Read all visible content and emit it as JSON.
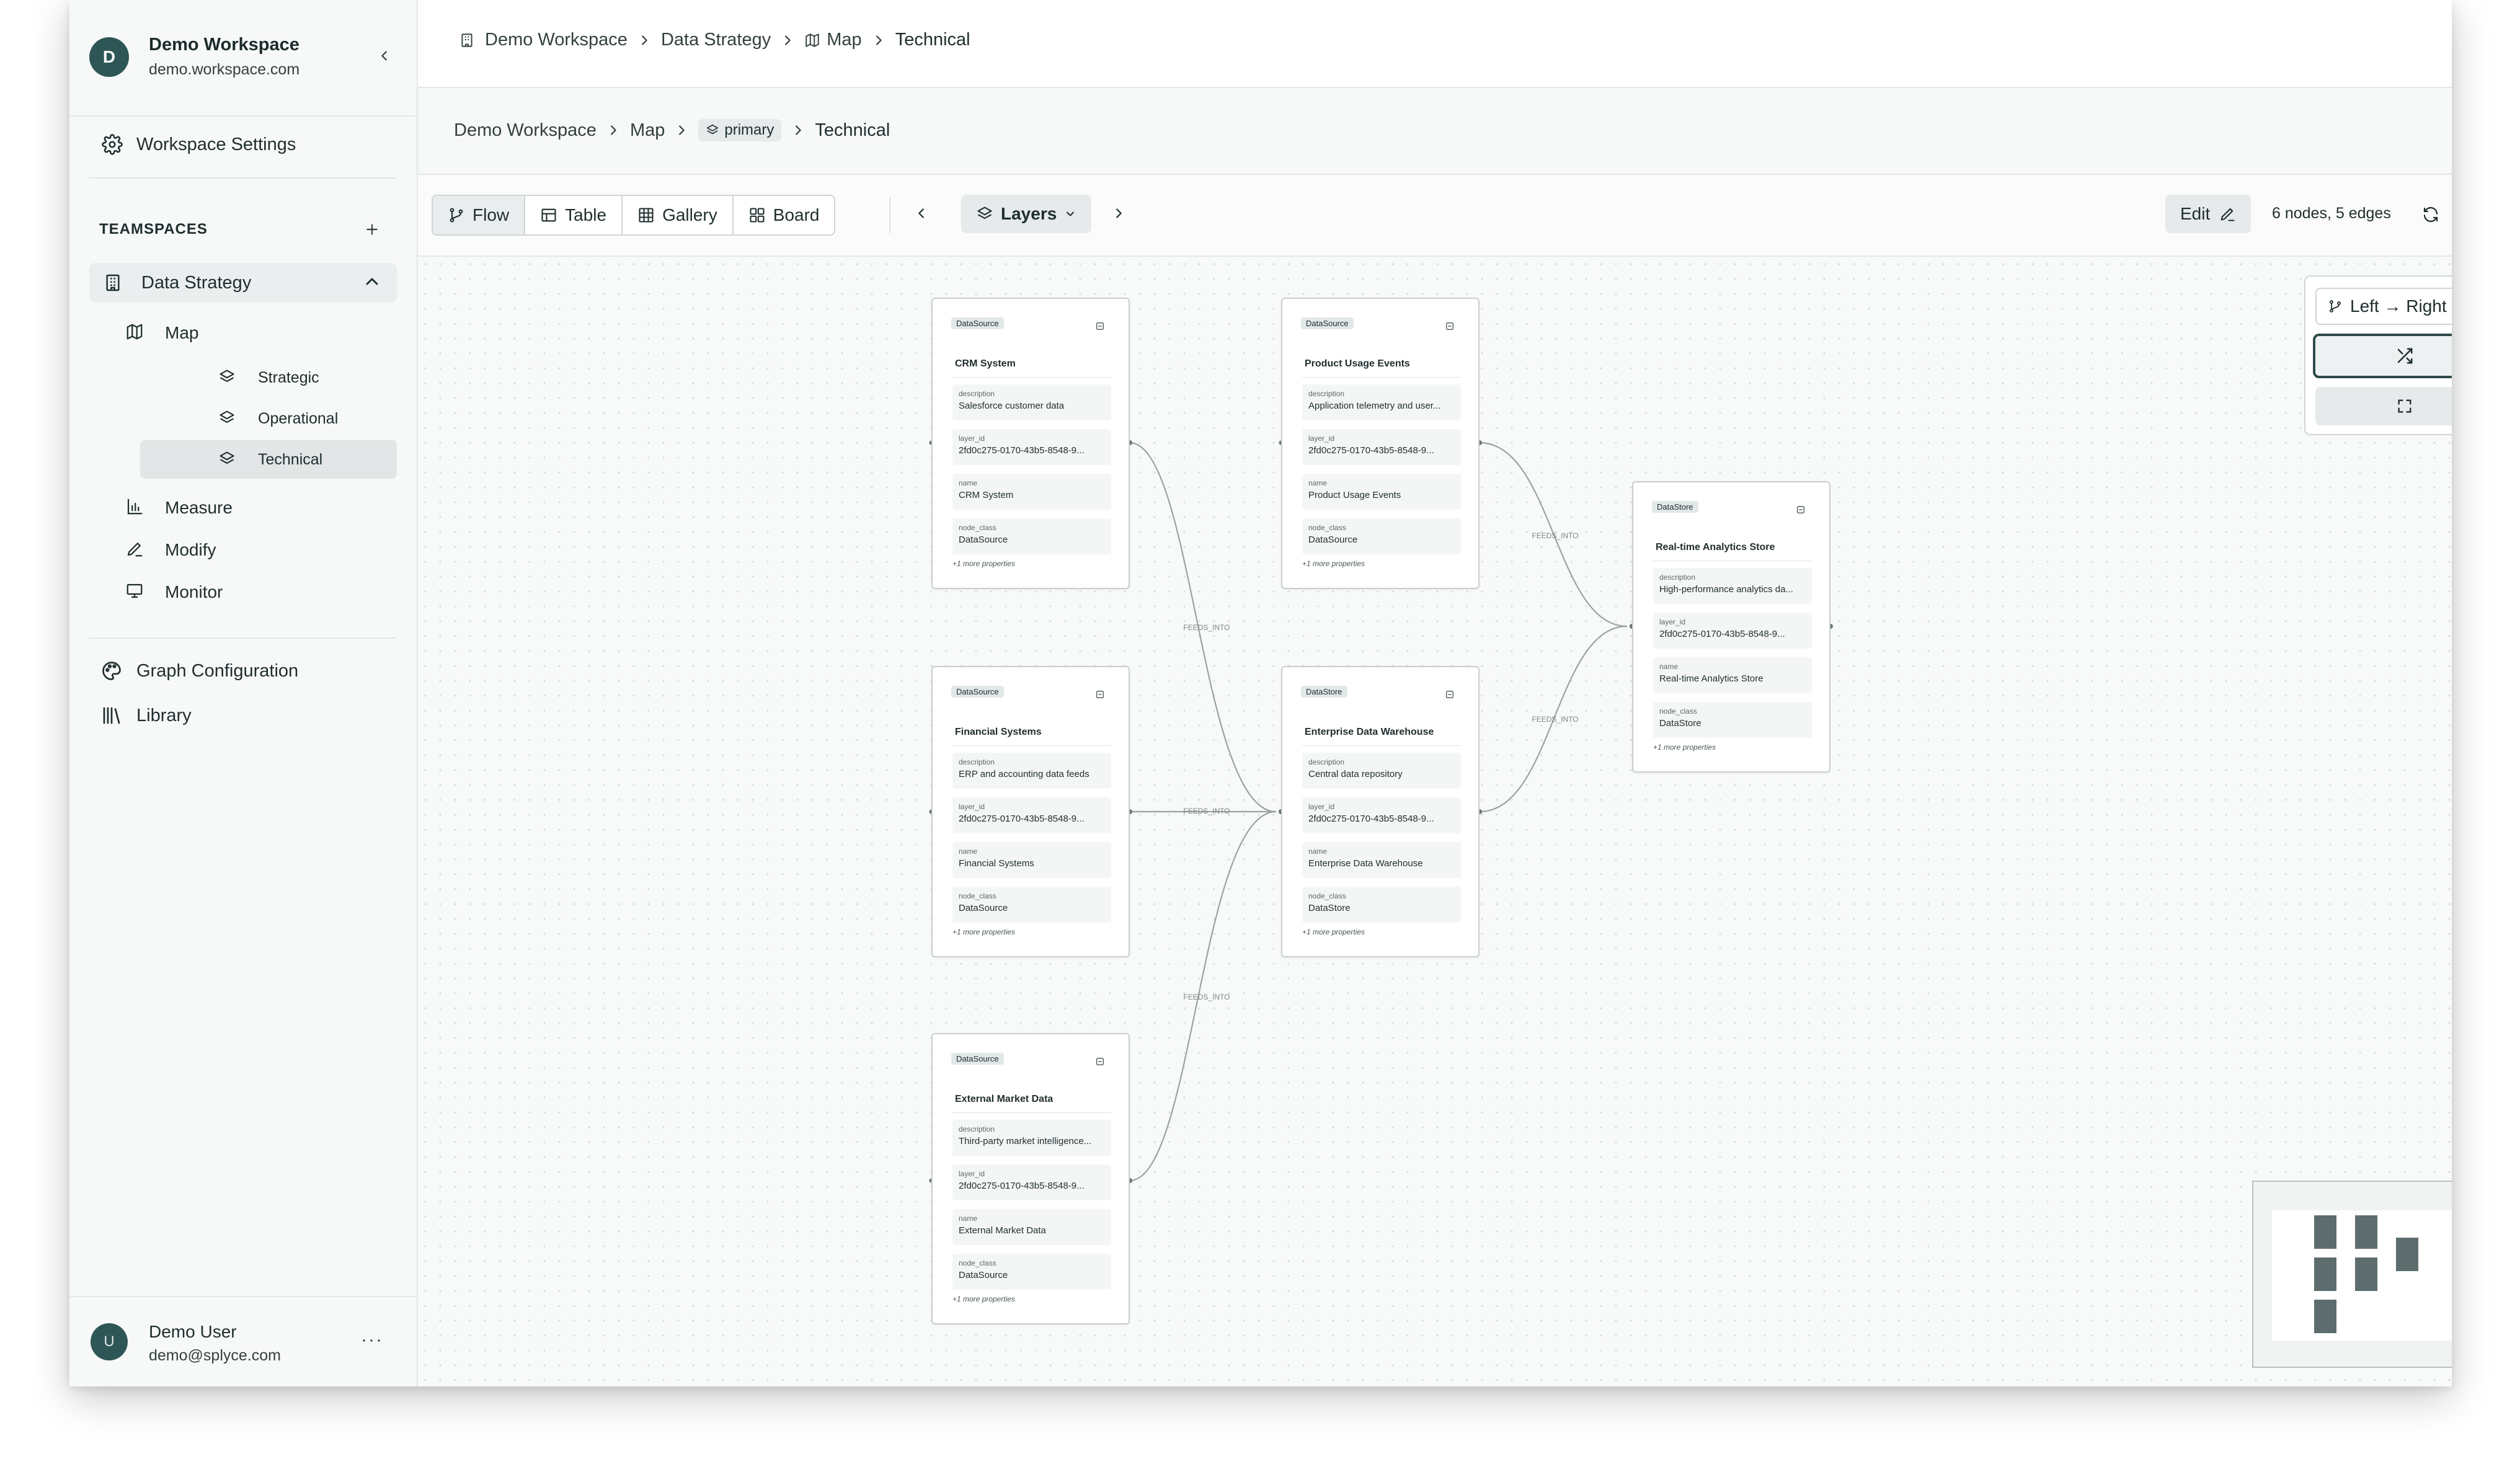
{
  "workspace": {
    "initial": "D",
    "name": "Demo Workspace",
    "domain": "demo.workspace.com"
  },
  "sidebar": {
    "workspace_settings": "Workspace Settings",
    "teamspaces_label": "TEAMSPACES",
    "teamspace": {
      "name": "Data Strategy",
      "expanded": true
    },
    "map_label": "Map",
    "layers": [
      {
        "label": "Strategic",
        "active": false
      },
      {
        "label": "Operational",
        "active": false
      },
      {
        "label": "Technical",
        "active": true
      }
    ],
    "items": [
      {
        "label": "Measure"
      },
      {
        "label": "Modify"
      },
      {
        "label": "Monitor"
      }
    ],
    "graph_configuration": "Graph Configuration",
    "library": "Library"
  },
  "user": {
    "initial": "U",
    "name": "Demo User",
    "email": "demo@splyce.com",
    "more": "···"
  },
  "topbar": {
    "breadcrumbs": [
      "Demo Workspace",
      "Data Strategy",
      "Map",
      "Technical"
    ]
  },
  "subbar": {
    "breadcrumbs": [
      "Demo Workspace",
      "Map",
      "primary",
      "Technical"
    ]
  },
  "toolbar": {
    "views": [
      {
        "label": "Flow",
        "active": true
      },
      {
        "label": "Table",
        "active": false
      },
      {
        "label": "Gallery",
        "active": false
      },
      {
        "label": "Board",
        "active": false
      }
    ],
    "layers_label": "Layers",
    "edit_label": "Edit",
    "count": "6 nodes, 5 edges"
  },
  "layout_panel": {
    "direction": "Left → Right"
  },
  "graph": {
    "more_properties": "+1 more properties",
    "edge_label": "FEEDS_INTO",
    "nodes": [
      {
        "type": "DataSource",
        "title": "CRM System",
        "props": [
          {
            "key": "description",
            "value": "Salesforce customer data"
          },
          {
            "key": "layer_id",
            "value": "2fd0c275-0170-43b5-8548-9..."
          },
          {
            "key": "name",
            "value": "CRM System"
          },
          {
            "key": "node_class",
            "value": "DataSource"
          }
        ]
      },
      {
        "type": "DataSource",
        "title": "Product Usage Events",
        "props": [
          {
            "key": "description",
            "value": "Application telemetry and user..."
          },
          {
            "key": "layer_id",
            "value": "2fd0c275-0170-43b5-8548-9..."
          },
          {
            "key": "name",
            "value": "Product Usage Events"
          },
          {
            "key": "node_class",
            "value": "DataSource"
          }
        ]
      },
      {
        "type": "DataStore",
        "title": "Real-time Analytics Store",
        "props": [
          {
            "key": "description",
            "value": "High-performance analytics da..."
          },
          {
            "key": "layer_id",
            "value": "2fd0c275-0170-43b5-8548-9..."
          },
          {
            "key": "name",
            "value": "Real-time Analytics Store"
          },
          {
            "key": "node_class",
            "value": "DataStore"
          }
        ]
      },
      {
        "type": "DataSource",
        "title": "Financial Systems",
        "props": [
          {
            "key": "description",
            "value": "ERP and accounting data feeds"
          },
          {
            "key": "layer_id",
            "value": "2fd0c275-0170-43b5-8548-9..."
          },
          {
            "key": "name",
            "value": "Financial Systems"
          },
          {
            "key": "node_class",
            "value": "DataSource"
          }
        ]
      },
      {
        "type": "DataStore",
        "title": "Enterprise Data Warehouse",
        "props": [
          {
            "key": "description",
            "value": "Central data repository"
          },
          {
            "key": "layer_id",
            "value": "2fd0c275-0170-43b5-8548-9..."
          },
          {
            "key": "name",
            "value": "Enterprise Data Warehouse"
          },
          {
            "key": "node_class",
            "value": "DataStore"
          }
        ]
      },
      {
        "type": "DataSource",
        "title": "External Market Data",
        "props": [
          {
            "key": "description",
            "value": "Third-party market intelligence..."
          },
          {
            "key": "layer_id",
            "value": "2fd0c275-0170-43b5-8548-9..."
          },
          {
            "key": "name",
            "value": "External Market Data"
          },
          {
            "key": "node_class",
            "value": "DataSource"
          }
        ]
      }
    ]
  },
  "zoom_controls": {
    "in": "+",
    "out": "−"
  }
}
